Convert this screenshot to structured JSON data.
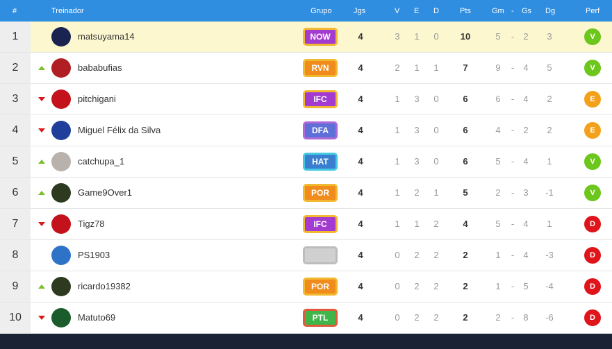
{
  "header": {
    "pos": "#",
    "coach": "Treinador",
    "group": "Grupo",
    "games": "Jgs",
    "wins": "V",
    "draws": "E",
    "losses": "D",
    "points": "Pts",
    "gf": "Gm",
    "dash": "-",
    "ga": "Gs",
    "gd": "Dg",
    "perf": "Perf"
  },
  "rows": [
    {
      "pos": "1",
      "trend": "none",
      "name": "matsuyama14",
      "group": "NOW",
      "group_color": "#a43bd0",
      "group_border": "#f2b830",
      "games": "4",
      "v": "3",
      "e": "1",
      "d": "0",
      "pts": "10",
      "gf": "5",
      "sep": "-",
      "ga": "2",
      "gd": "3",
      "perf": "V",
      "perf_color": "#6cc61b",
      "avatar_color": "#1b2350"
    },
    {
      "pos": "2",
      "trend": "up",
      "name": "bababufias",
      "group": "RVN",
      "group_color": "#f08c1c",
      "group_border": "#f2b830",
      "games": "4",
      "v": "2",
      "e": "1",
      "d": "1",
      "pts": "7",
      "gf": "9",
      "sep": "-",
      "ga": "4",
      "gd": "5",
      "perf": "V",
      "perf_color": "#6cc61b",
      "avatar_color": "#b01f24"
    },
    {
      "pos": "3",
      "trend": "down",
      "name": "pitchigani",
      "group": "IFC",
      "group_color": "#a43bd0",
      "group_border": "#f2b830",
      "games": "4",
      "v": "1",
      "e": "3",
      "d": "0",
      "pts": "6",
      "gf": "6",
      "sep": "-",
      "ga": "4",
      "gd": "2",
      "perf": "E",
      "perf_color": "#f3a01b",
      "avatar_color": "#c3121b"
    },
    {
      "pos": "4",
      "trend": "down",
      "name": "Miguel Félix da Silva",
      "group": "DFA",
      "group_color": "#5e6fd8",
      "group_border": "#b06ad8",
      "games": "4",
      "v": "1",
      "e": "3",
      "d": "0",
      "pts": "6",
      "gf": "4",
      "sep": "-",
      "ga": "2",
      "gd": "2",
      "perf": "E",
      "perf_color": "#f3a01b",
      "avatar_color": "#1f3f9a"
    },
    {
      "pos": "5",
      "trend": "up",
      "name": "catchupa_1",
      "group": "HAT",
      "group_color": "#3a7fcf",
      "group_border": "#45c9e3",
      "games": "4",
      "v": "1",
      "e": "3",
      "d": "0",
      "pts": "6",
      "gf": "5",
      "sep": "-",
      "ga": "4",
      "gd": "1",
      "perf": "V",
      "perf_color": "#6cc61b",
      "avatar_color": "#b9b2ac"
    },
    {
      "pos": "6",
      "trend": "up",
      "name": "Game9Over1",
      "group": "POR",
      "group_color": "#f08c1c",
      "group_border": "#f2b830",
      "games": "4",
      "v": "1",
      "e": "2",
      "d": "1",
      "pts": "5",
      "gf": "2",
      "sep": "-",
      "ga": "3",
      "gd": "-1",
      "perf": "V",
      "perf_color": "#6cc61b",
      "avatar_color": "#2d3a1f"
    },
    {
      "pos": "7",
      "trend": "down",
      "name": "Tigz78",
      "group": "IFC",
      "group_color": "#a43bd0",
      "group_border": "#f2b830",
      "games": "4",
      "v": "1",
      "e": "1",
      "d": "2",
      "pts": "4",
      "gf": "5",
      "sep": "-",
      "ga": "4",
      "gd": "1",
      "perf": "D",
      "perf_color": "#e0141b",
      "avatar_color": "#c3121b"
    },
    {
      "pos": "8",
      "trend": "none",
      "name": "PS1903",
      "group": "",
      "group_color": "#d0d0d0",
      "group_border": "#bdbdbd",
      "games": "4",
      "v": "0",
      "e": "2",
      "d": "2",
      "pts": "2",
      "gf": "1",
      "sep": "-",
      "ga": "4",
      "gd": "-3",
      "perf": "D",
      "perf_color": "#e0141b",
      "avatar_color": "#2f73c8"
    },
    {
      "pos": "9",
      "trend": "up",
      "name": "ricardo19382",
      "group": "POR",
      "group_color": "#f08c1c",
      "group_border": "#f2b830",
      "games": "4",
      "v": "0",
      "e": "2",
      "d": "2",
      "pts": "2",
      "gf": "1",
      "sep": "-",
      "ga": "5",
      "gd": "-4",
      "perf": "D",
      "perf_color": "#e0141b",
      "avatar_color": "#2d3a1f"
    },
    {
      "pos": "10",
      "trend": "down",
      "name": "Matuto69",
      "group": "PTL",
      "group_color": "#3fb54a",
      "group_border": "#e25a3c",
      "games": "4",
      "v": "0",
      "e": "2",
      "d": "2",
      "pts": "2",
      "gf": "2",
      "sep": "-",
      "ga": "8",
      "gd": "-6",
      "perf": "D",
      "perf_color": "#e0141b",
      "avatar_color": "#1b5c2c"
    }
  ]
}
